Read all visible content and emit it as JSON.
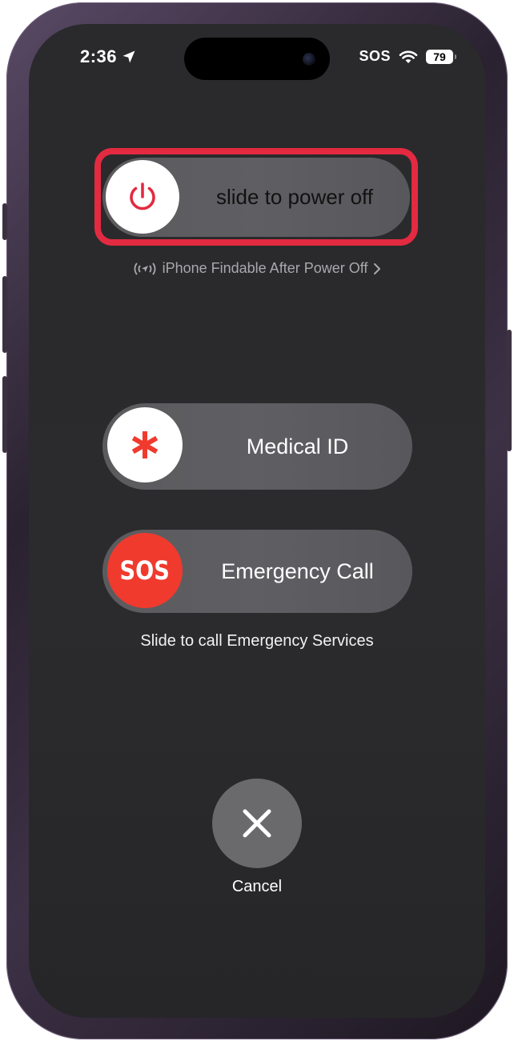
{
  "status_bar": {
    "time": "2:36",
    "location_icon": "location-arrow-icon",
    "sos": "SOS",
    "wifi_icon": "wifi-icon",
    "battery": "79"
  },
  "power_off": {
    "label": "slide to power off",
    "icon": "power-icon",
    "accent": "#e32a41"
  },
  "findable": {
    "text": "iPhone Findable After Power Off",
    "icon": "findmy-signal-icon",
    "chevron": "chevron-right-icon"
  },
  "medical_id": {
    "label": "Medical ID",
    "icon": "asterisk-icon",
    "icon_color": "#f03a2e"
  },
  "emergency": {
    "knob_text": "SOS",
    "label": "Emergency Call",
    "knob_color": "#f03a2e",
    "caption": "Slide to call Emergency Services"
  },
  "cancel": {
    "label": "Cancel",
    "icon": "close-icon"
  }
}
